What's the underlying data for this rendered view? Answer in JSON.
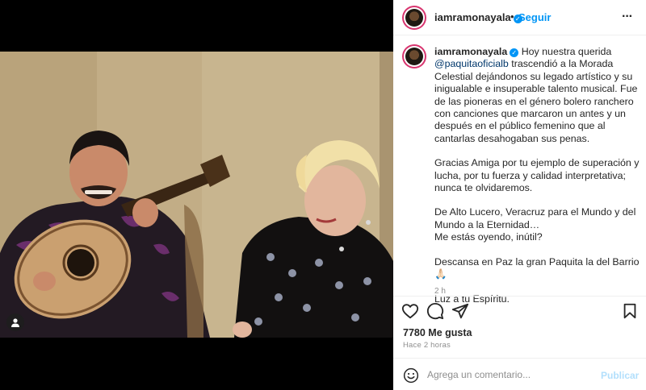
{
  "post": {
    "username": "iamramonayala",
    "follow_separator": "•",
    "follow_label": "Seguir",
    "more_icon": "more-horizontal-icon",
    "verified_icon": "verified-badge-icon",
    "caption": {
      "username": "iamramonayala",
      "intro": "Hoy nuestra querida",
      "mention": "@paquitaoficialb",
      "p1_rest": "trascendió a la Morada Celestial dejándonos su legado artístico y su inigualable e insuperable talento musical. Fue de las pioneras en el género bolero ranchero con canciones que marcaron un antes y un después en el público femenino que al cantarlas desahogaban sus penas.",
      "p2": "Gracias Amiga por tu ejemplo de superación y lucha, por tu fuerza y calidad interpretativa; nunca te olvidaremos.",
      "p3_line1": "De Alto Lucero, Veracruz para el Mundo y del Mundo a la Eternidad…",
      "p3_line2": "Me estás oyendo, inútil?",
      "p4": "Descansa en Paz la gran Paquita la del Barrio",
      "p4_emoji": "🙏🏻",
      "p5": "Luz a tu Espíritu."
    },
    "caption_time": "2 h",
    "likes": "7780 Me gusta",
    "time_ago": "Hace 2 horas",
    "comment_placeholder": "Agrega un comentario...",
    "publish_label": "Publicar",
    "icons": [
      "heart-icon",
      "comment-icon",
      "share-icon",
      "bookmark-icon",
      "emoji-icon",
      "user-tag-icon"
    ],
    "colors": {
      "accent": "#0095f6",
      "publish_disabled": "#b2dffc",
      "text": "#262626",
      "muted": "#8e8e8e"
    }
  }
}
